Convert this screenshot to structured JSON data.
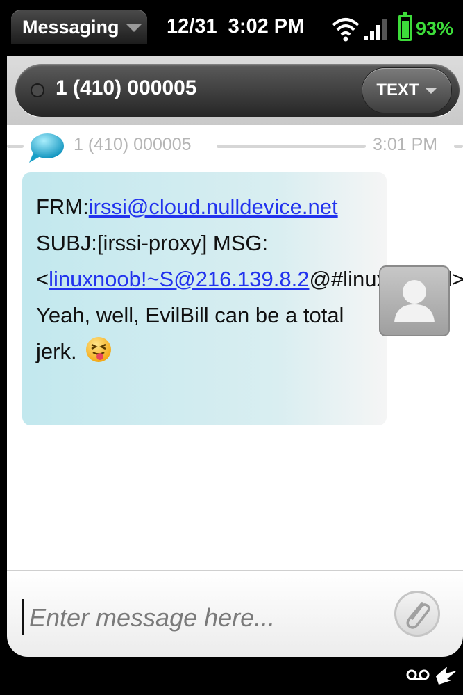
{
  "status_bar": {
    "app_menu_label": "Messaging",
    "date_time": "12/31  3:02 PM",
    "battery_percent": "93%",
    "battery_color": "#3ddc3a"
  },
  "header": {
    "contact": "1 (410) 000005",
    "transport_label": "TEXT"
  },
  "conversation": {
    "divider": {
      "sender": "1 (410) 000005",
      "time": "3:01 PM"
    },
    "message": {
      "part1": "FRM:",
      "link1": "irssi@cloud.nulldevice.net",
      "part2": " SUBJ:[irssi-proxy] MSG:<",
      "link2": "linuxnoob!~S@216.139.8.2",
      "part3": "@#linuxjournal> Yeah, well, EvilBill can be a total jerk.",
      "emoji": "tongue-out-smiley",
      "bubble_color": "#c2e8ee",
      "link_color": "#2233ee"
    }
  },
  "compose": {
    "placeholder": "Enter message here..."
  },
  "icons": {
    "wifi": "wifi-icon",
    "signal": "signal-icon",
    "battery": "battery-icon",
    "chat": "chat-bubble-icon",
    "avatar": "contact-avatar-icon",
    "attach": "paperclip-icon",
    "voicemail": "voicemail-icon",
    "gesture": "gesture-area-icon"
  }
}
